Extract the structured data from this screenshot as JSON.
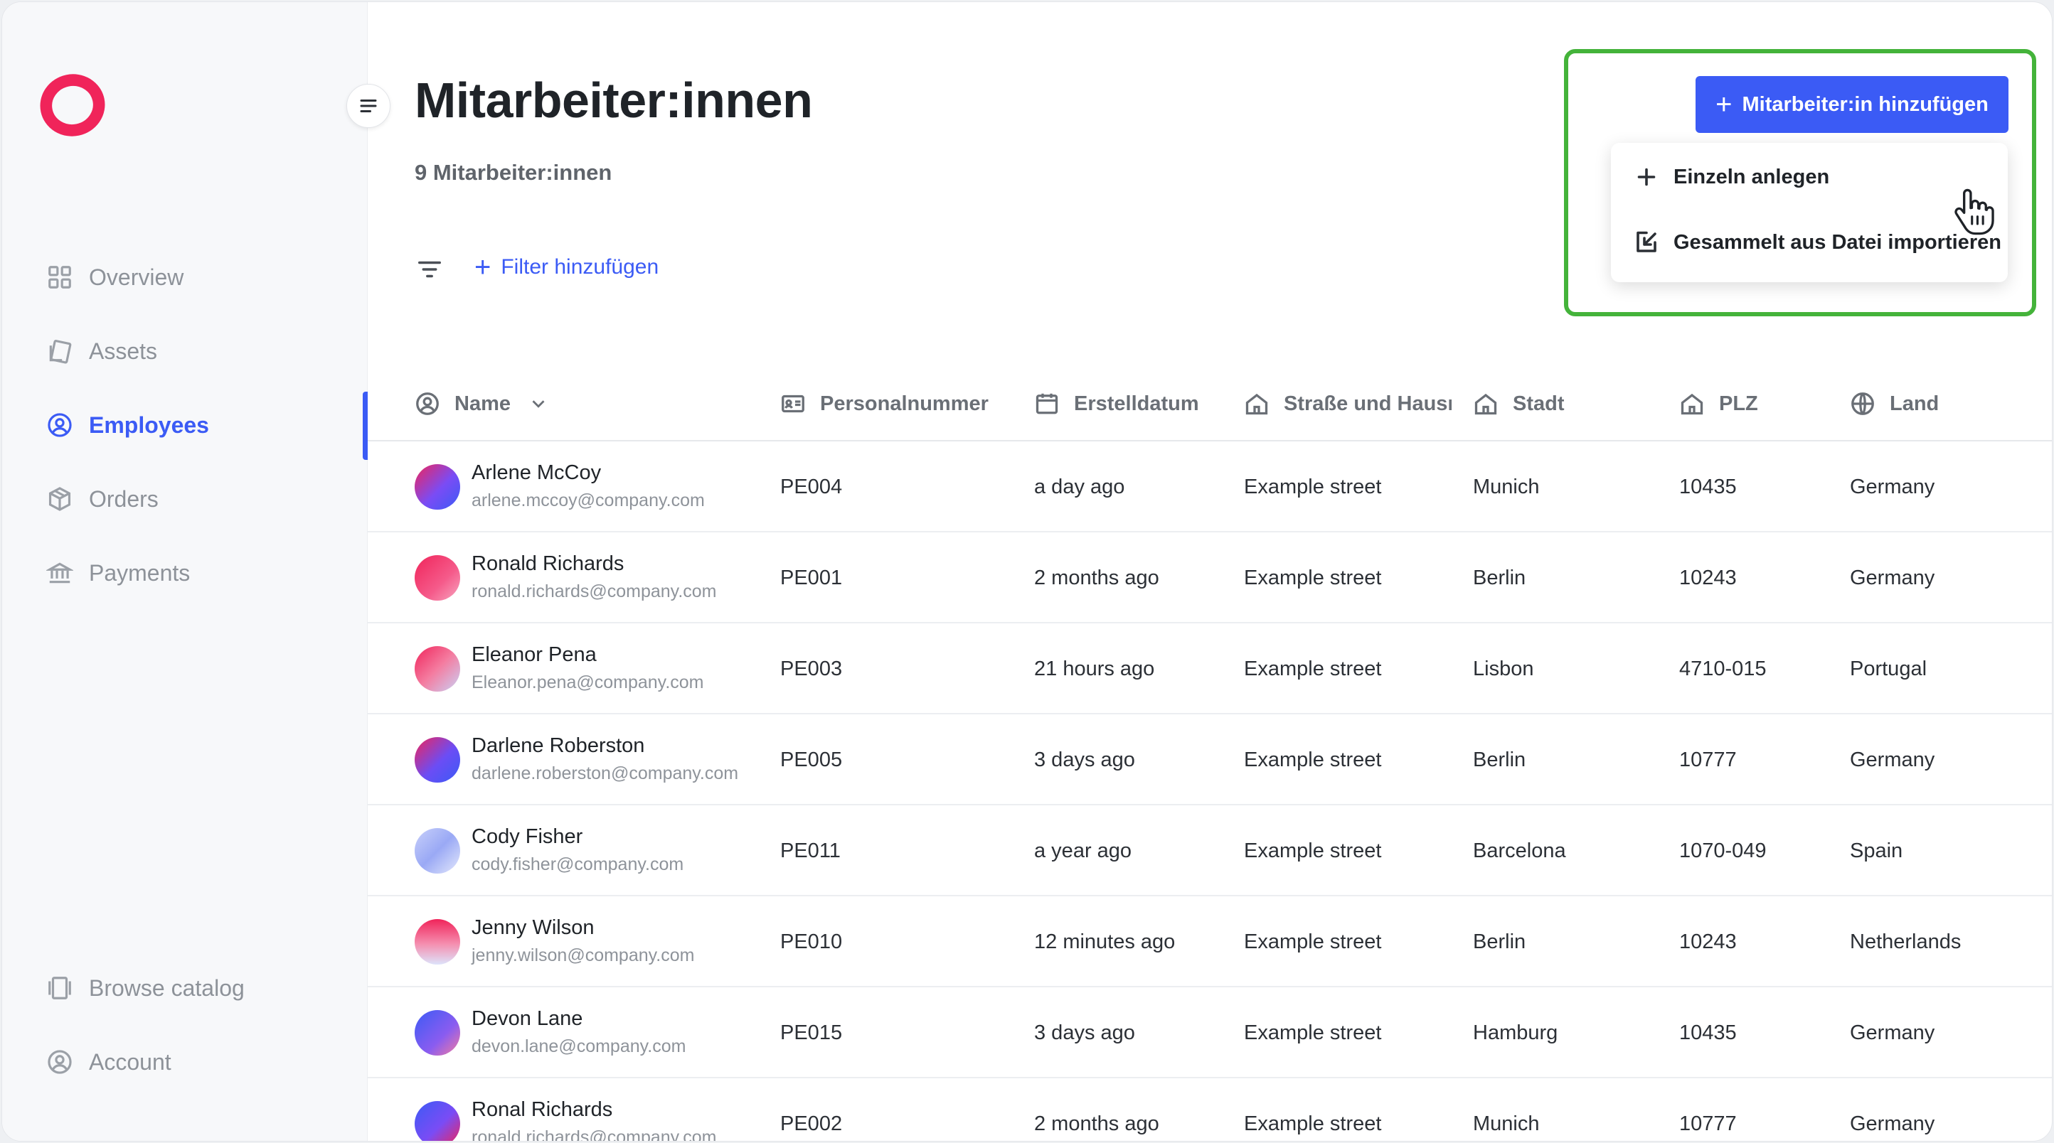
{
  "sidebar": {
    "nav": [
      {
        "label": "Overview",
        "icon": "grid-icon"
      },
      {
        "label": "Assets",
        "icon": "assets-icon"
      },
      {
        "label": "Employees",
        "icon": "user-circle-icon",
        "active": true
      },
      {
        "label": "Orders",
        "icon": "box-icon"
      },
      {
        "label": "Payments",
        "icon": "bank-icon"
      }
    ],
    "bottom": [
      {
        "label": "Browse catalog",
        "icon": "catalog-icon"
      },
      {
        "label": "Account",
        "icon": "user-circle-icon"
      }
    ]
  },
  "header": {
    "title": "Mitarbeiter:innen",
    "subtitle": "9 Mitarbeiter:innen",
    "add_filter_label": "Filter hinzufügen",
    "add_button_label": "Mitarbeiter:in hinzufügen"
  },
  "dropdown": {
    "items": [
      {
        "label": "Einzeln anlegen",
        "icon": "plus-icon"
      },
      {
        "label": "Gesammelt aus Datei importieren",
        "icon": "import-icon"
      }
    ]
  },
  "table": {
    "columns": [
      "Name",
      "Personalnummer",
      "Erstelldatum",
      "Straße und Hausı",
      "Stadt",
      "PLZ",
      "Land"
    ],
    "rows": [
      {
        "name": "Arlene McCoy",
        "email": "arlene.mccoy@company.com",
        "id": "PE004",
        "created": "a day ago",
        "street": "Example street",
        "city": "Munich",
        "zip": "10435",
        "country": "Germany"
      },
      {
        "name": "Ronald Richards",
        "email": "ronald.richards@company.com",
        "id": "PE001",
        "created": "2 months ago",
        "street": "Example street",
        "city": "Berlin",
        "zip": "10243",
        "country": "Germany"
      },
      {
        "name": "Eleanor Pena",
        "email": "Eleanor.pena@company.com",
        "id": "PE003",
        "created": "21 hours ago",
        "street": "Example street",
        "city": "Lisbon",
        "zip": "4710-015",
        "country": "Portugal"
      },
      {
        "name": "Darlene Roberston",
        "email": "darlene.roberston@company.com",
        "id": "PE005",
        "created": "3 days ago",
        "street": "Example street",
        "city": "Berlin",
        "zip": "10777",
        "country": "Germany"
      },
      {
        "name": "Cody Fisher",
        "email": "cody.fisher@company.com",
        "id": "PE011",
        "created": "a year ago",
        "street": "Example street",
        "city": "Barcelona",
        "zip": "1070-049",
        "country": "Spain"
      },
      {
        "name": "Jenny Wilson",
        "email": "jenny.wilson@company.com",
        "id": "PE010",
        "created": "12 minutes ago",
        "street": "Example street",
        "city": "Berlin",
        "zip": "10243",
        "country": "Netherlands"
      },
      {
        "name": "Devon Lane",
        "email": "devon.lane@company.com",
        "id": "PE015",
        "created": "3 days ago",
        "street": "Example street",
        "city": "Hamburg",
        "zip": "10435",
        "country": "Germany"
      },
      {
        "name": "Ronal Richards",
        "email": "ronald.richards@company.com",
        "id": "PE002",
        "created": "2 months ago",
        "street": "Example street",
        "city": "Munich",
        "zip": "10777",
        "country": "Germany"
      }
    ]
  },
  "colors": {
    "accent": "#3b5bf5",
    "highlight": "#44b33a",
    "logo": "#f0245a"
  }
}
